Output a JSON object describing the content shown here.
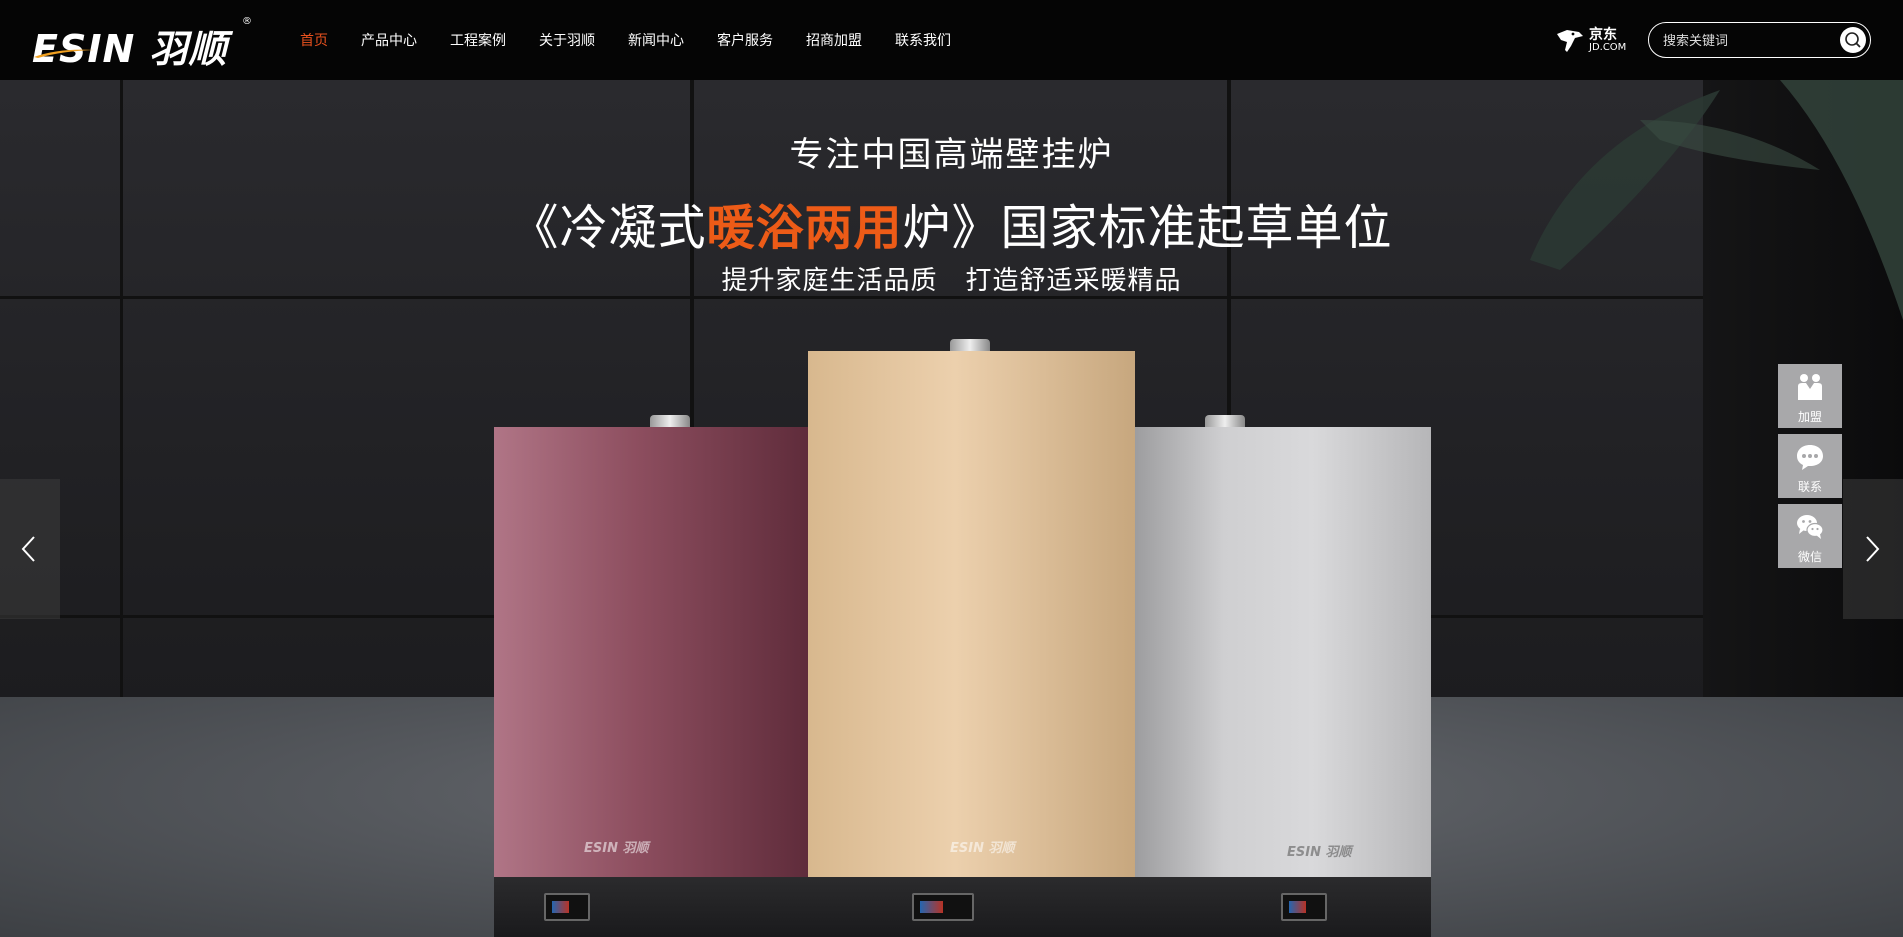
{
  "header": {
    "logo_text": "ESIN 羽顺",
    "logo_registered": "®",
    "nav": [
      {
        "label": "首页",
        "active": true
      },
      {
        "label": "产品中心",
        "active": false
      },
      {
        "label": "工程案例",
        "active": false
      },
      {
        "label": "关于羽顺",
        "active": false
      },
      {
        "label": "新闻中心",
        "active": false
      },
      {
        "label": "客户服务",
        "active": false
      },
      {
        "label": "招商加盟",
        "active": false
      },
      {
        "label": "联系我们",
        "active": false
      }
    ],
    "jd": {
      "cn": "京东",
      "en": "JD.COM"
    },
    "search": {
      "placeholder": "搜索关键词",
      "icon": "search-icon"
    }
  },
  "hero": {
    "line1": "专注中国高端壁挂炉",
    "line2_pre": "《冷凝式",
    "line2_highlight": "暖浴两用",
    "line2_post": "炉》国家标准起草单位",
    "line3_a": "提升家庭生活品质",
    "line3_b": "打造舒适采暖精品",
    "highlight_color": "#ed5b17",
    "product_brand": "ESIN 羽顺"
  },
  "carousel": {
    "prev_icon": "chevron-left-icon",
    "next_icon": "chevron-right-icon"
  },
  "side_tools": [
    {
      "label": "加盟",
      "icon": "handshake-icon"
    },
    {
      "label": "联系",
      "icon": "chat-bubble-icon"
    },
    {
      "label": "微信",
      "icon": "wechat-icon"
    }
  ],
  "colors": {
    "accent": "#e8511e",
    "header_bg": "#050505",
    "side_tool_bg": "#a8a8aa"
  }
}
